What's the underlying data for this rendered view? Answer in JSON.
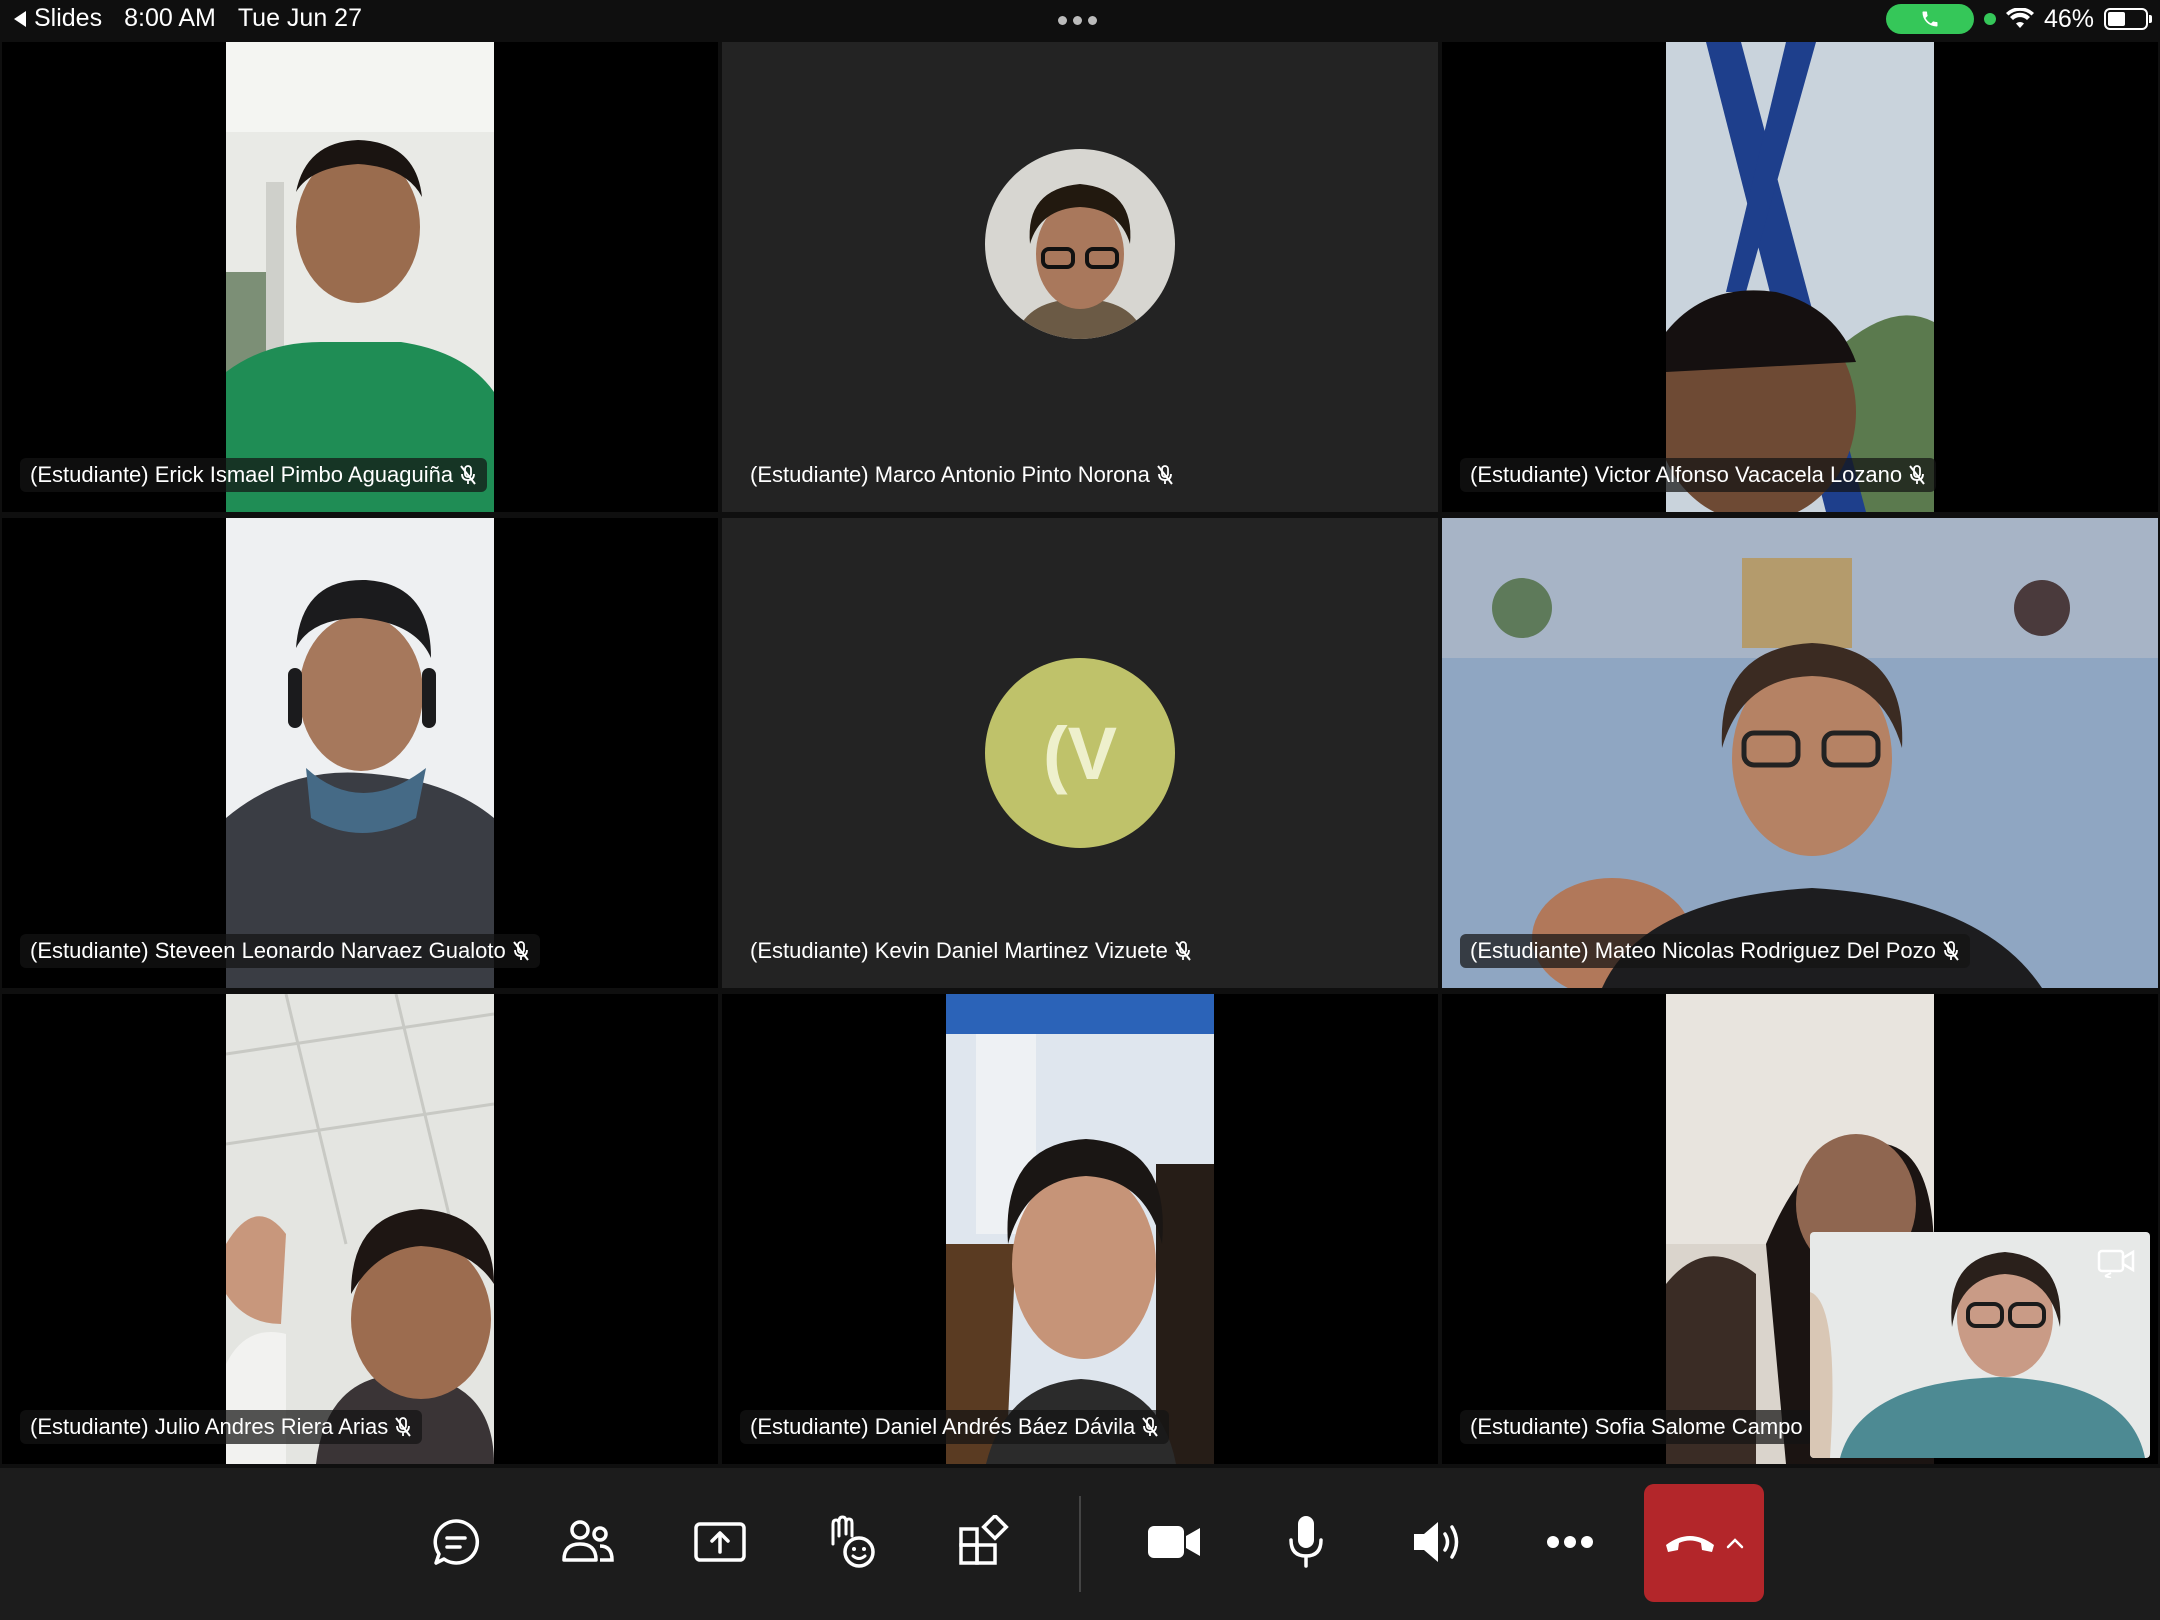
{
  "status_bar": {
    "back_app": "Slides",
    "time": "8:00 AM",
    "date": "Tue Jun 27",
    "battery": "46%",
    "battery_level": 0.46
  },
  "participants": [
    {
      "name": "(Estudiante) Erick Ismael Pimbo Aguaguiña",
      "muted": true
    },
    {
      "name": "(Estudiante) Marco Antonio Pinto Norona",
      "muted": true
    },
    {
      "name": "(Estudiante) Victor Alfonso Vacacela Lozano",
      "muted": true
    },
    {
      "name": "(Estudiante) Steveen Leonardo Narvaez Gualoto",
      "muted": true
    },
    {
      "name": "(Estudiante) Kevin Daniel Martinez Vizuete",
      "muted": true,
      "initials": "(V",
      "avatar_color": "#bfc26a"
    },
    {
      "name": "(Estudiante) Mateo Nicolas Rodriguez Del Pozo",
      "muted": true
    },
    {
      "name": "(Estudiante) Julio Andres Riera Arias",
      "muted": true
    },
    {
      "name": "(Estudiante) Daniel Andrés Báez Dávila",
      "muted": true
    },
    {
      "name": "(Estudiante) Sofia Salome Campo",
      "muted": false
    }
  ],
  "toolbar": {
    "icons": [
      "chat-icon",
      "participants-icon",
      "share-screen-icon",
      "reactions-icon",
      "apps-icon",
      "video-icon",
      "microphone-icon",
      "speaker-icon",
      "more-icon",
      "leave-icon"
    ],
    "leave_color": "#b3262a"
  }
}
